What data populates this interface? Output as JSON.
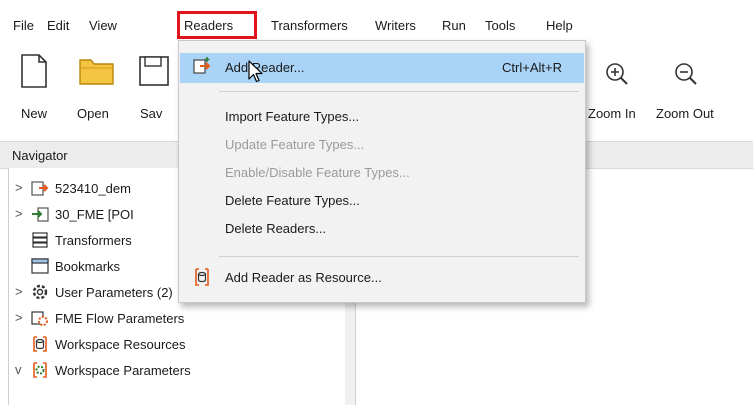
{
  "menubar": {
    "items": [
      "File",
      "Edit",
      "View",
      "Readers",
      "Transformers",
      "Writers",
      "Run",
      "Tools",
      "Help"
    ]
  },
  "toolbar": {
    "new_label": "New",
    "open_label": "Open",
    "save_label": "Sav",
    "zoom_in_label": "Zoom In",
    "zoom_out_label": "Zoom Out"
  },
  "navigator": {
    "title": "Navigator",
    "items": [
      {
        "label": "523410_dem",
        "expand": ">",
        "icon": "reader-icon"
      },
      {
        "label": "30_FME [POI",
        "expand": ">",
        "icon": "writer-icon"
      },
      {
        "label": "Transformers",
        "expand": "",
        "icon": "transformers-icon"
      },
      {
        "label": "Bookmarks",
        "expand": "",
        "icon": "bookmark-icon"
      },
      {
        "label": "User Parameters (2)",
        "expand": ">",
        "icon": "gear-icon"
      },
      {
        "label": "FME Flow Parameters",
        "expand": ">",
        "icon": "flow-parameters-icon"
      },
      {
        "label": "Workspace Resources",
        "expand": "",
        "icon": "resources-icon"
      },
      {
        "label": "Workspace Parameters",
        "expand": "v",
        "icon": "workspace-parameters-icon"
      }
    ]
  },
  "readers_menu": {
    "items": [
      {
        "label": "Add Reader...",
        "shortcut": "Ctrl+Alt+R",
        "disabled": false
      },
      {
        "label": "Import Feature Types...",
        "disabled": false
      },
      {
        "label": "Update Feature Types...",
        "disabled": true
      },
      {
        "label": "Enable/Disable Feature Types...",
        "disabled": true
      },
      {
        "label": "Delete Feature Types...",
        "disabled": false
      },
      {
        "label": "Delete Readers...",
        "disabled": false
      },
      {
        "label": "Add Reader as Resource...",
        "disabled": false
      }
    ]
  },
  "colors": {
    "highlight_border": "#e3131b",
    "hover_bg": "#a9d3f7",
    "disabled_text": "#9a9a9a",
    "folder_yellow": "#f4c542"
  }
}
